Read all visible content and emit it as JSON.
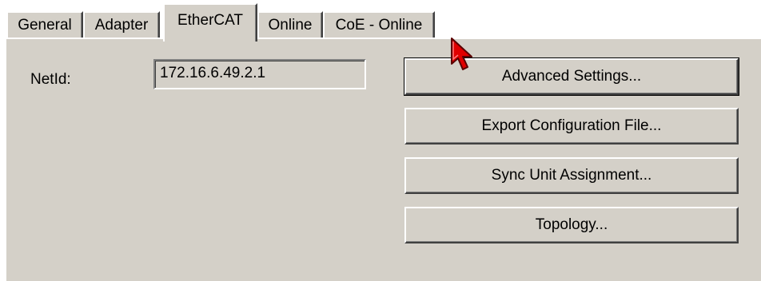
{
  "tabs": [
    {
      "label": "General",
      "active": false
    },
    {
      "label": "Adapter",
      "active": false
    },
    {
      "label": "EtherCAT",
      "active": true
    },
    {
      "label": "Online",
      "active": false
    },
    {
      "label": "CoE - Online",
      "active": false
    }
  ],
  "form": {
    "netid_label": "NetId:",
    "netid_value": "172.16.6.49.2.1"
  },
  "buttons": {
    "advanced_settings": "Advanced Settings...",
    "export_configuration": "Export Configuration File...",
    "sync_unit_assignment": "Sync Unit Assignment...",
    "topology": "Topology..."
  },
  "colors": {
    "dialog_face": "#d4d0c8",
    "cursor_fill": "#e00000"
  },
  "icons": {
    "cursor": "arrow-pointer-icon"
  }
}
